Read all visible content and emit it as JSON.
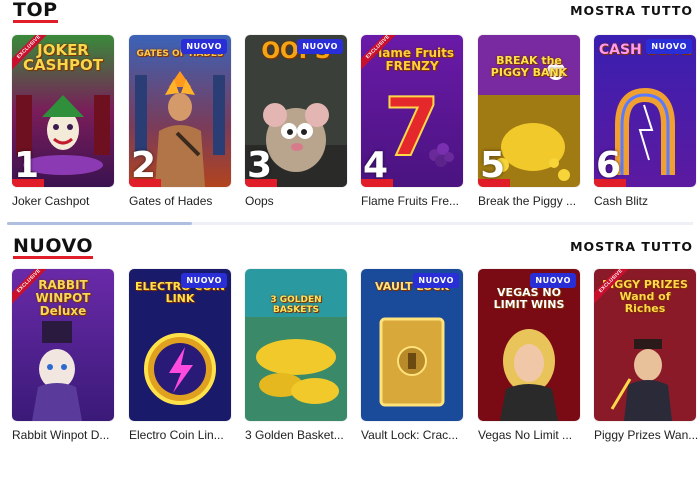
{
  "sections": [
    {
      "title": "TOP",
      "show_all": "MOSTRA TUTTO",
      "games": [
        {
          "name": "Joker Cashpot",
          "logo": "JOKER CASHPOT",
          "rank": "1",
          "badge": "",
          "exclusive": true
        },
        {
          "name": "Gates of Hades",
          "logo": "GATES OF HADES",
          "rank": "2",
          "badge": "NUOVO",
          "exclusive": false
        },
        {
          "name": "Oops",
          "logo": "OOPS",
          "rank": "3",
          "badge": "NUOVO",
          "exclusive": false
        },
        {
          "name": "Flame Fruits Fre...",
          "logo": "Flame Fruits FRENZY",
          "rank": "4",
          "badge": "",
          "exclusive": true
        },
        {
          "name": "Break the Piggy ...",
          "logo": "BREAK the PIGGY BANK",
          "rank": "5",
          "badge": "",
          "exclusive": false
        },
        {
          "name": "Cash Blitz",
          "logo": "CASH BLITZ",
          "rank": "6",
          "badge": "NUOVO",
          "exclusive": false
        }
      ]
    },
    {
      "title": "NUOVO",
      "show_all": "MOSTRA TUTTO",
      "games": [
        {
          "name": "Rabbit Winpot D...",
          "logo": "RABBIT WINPOT Deluxe",
          "badge": "",
          "exclusive": true
        },
        {
          "name": "Electro Coin Lin...",
          "logo": "ELECTRO COIN LINK",
          "badge": "NUOVO",
          "exclusive": false
        },
        {
          "name": "3 Golden Basket...",
          "logo": "3 GOLDEN BASKETS",
          "badge": "",
          "exclusive": false
        },
        {
          "name": "Vault Lock: Crac...",
          "logo": "VAULT LOCK",
          "badge": "NUOVO",
          "exclusive": false
        },
        {
          "name": "Vegas No Limit ...",
          "logo": "VEGAS NO LIMIT WINS",
          "badge": "NUOVO",
          "exclusive": false
        },
        {
          "name": "Piggy Prizes Wan...",
          "logo": "PIGGY PRIZES Wand of Riches",
          "badge": "",
          "exclusive": true
        }
      ]
    }
  ],
  "exclusive_label": "EXCLUSIVE",
  "colors": {
    "accent_red": "#e11d2a",
    "badge_blue": "#2a2ed6",
    "scroll_thumb": "#aebfe0"
  }
}
